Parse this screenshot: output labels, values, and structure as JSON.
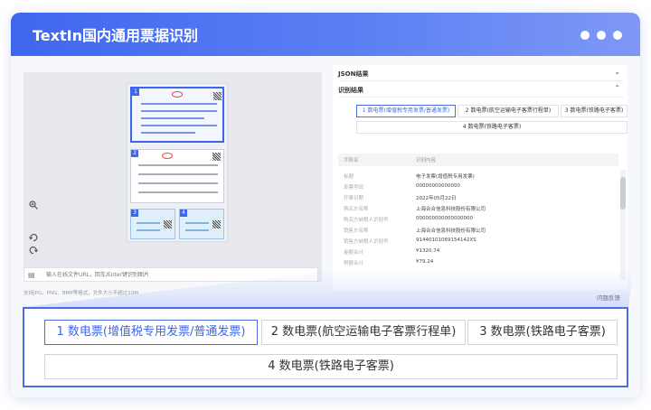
{
  "app": {
    "title": "TextIn国内通用票据识别"
  },
  "viewer": {
    "input_placeholder": "输入在线文件URL，回车/Enter键识别图片",
    "hint_text": "支持JPG、PNG、BMP等格式，文件大小不超过10M",
    "page_badges": [
      "1",
      "2",
      "3",
      "4"
    ]
  },
  "panel": {
    "json_section": "JSON结果",
    "result_section": "识别结果",
    "tabs": [
      "1 数电票(增值税专用发票/普通发票)",
      "2 数电票(航空运输电子客票行程单)",
      "3 数电票(铁路电子客票)",
      "4 数电票(铁路电子客票)"
    ],
    "table_header": {
      "key": "字段名",
      "value": "识别内容"
    },
    "rows": [
      {
        "key": "标题",
        "value": "电子发票(增值税专用发票)"
      },
      {
        "key": "发票号码",
        "value": "00000000000000"
      },
      {
        "key": "开票日期",
        "value": "2022年05月22日"
      },
      {
        "key": "购买方名称",
        "value": "上海合合信息科技股份有限公司"
      },
      {
        "key": "购买方纳税人识别号",
        "value": "000000000000000000"
      },
      {
        "key": "销售方名称",
        "value": "上海合合信息科技股份有限公司"
      },
      {
        "key": "销售方纳税人识别号",
        "value": "91440101069154142XS"
      },
      {
        "key": "金额合计",
        "value": "¥1320.74"
      },
      {
        "key": "税额合计",
        "value": "¥79.24"
      }
    ],
    "feedback": "问题反馈"
  },
  "callout": {
    "tabs": [
      "1 数电票(增值税专用发票/普通发票)",
      "2 数电票(航空运输电子客票行程单)",
      "3 数电票(铁路电子客票)",
      "4 数电票(铁路电子客票)"
    ],
    "active_index": 0
  },
  "colors": {
    "accent": "#3f67ee",
    "titlebar_end": "#7e98f6"
  }
}
